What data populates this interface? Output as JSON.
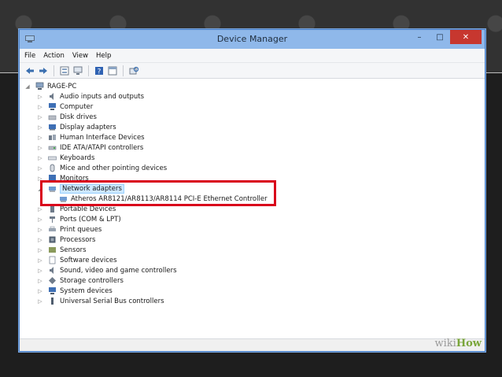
{
  "window": {
    "title": "Device Manager",
    "controls": {
      "minimize": "–",
      "maximize": "□",
      "close": "✕"
    }
  },
  "menu": [
    "File",
    "Action",
    "View",
    "Help"
  ],
  "toolbar": [
    "back-arrow-icon",
    "forward-arrow-icon",
    "properties-icon",
    "computer-icon",
    "help-icon",
    "console-icon",
    "scan-hardware-icon"
  ],
  "tree": {
    "root": "RAGE-PC",
    "items": [
      "Audio inputs and outputs",
      "Computer",
      "Disk drives",
      "Display adapters",
      "Human Interface Devices",
      "IDE ATA/ATAPI controllers",
      "Keyboards",
      "Mice and other pointing devices",
      "Monitors",
      "Network adapters",
      "Atheros AR8121/AR8113/AR8114 PCI-E Ethernet Controller",
      "Portable Devices",
      "Ports (COM & LPT)",
      "Print queues",
      "Processors",
      "Sensors",
      "Software devices",
      "Sound, video and game controllers",
      "Storage controllers",
      "System devices",
      "Universal Serial Bus controllers"
    ]
  },
  "watermark": {
    "wiki": "wiki",
    "how": "How"
  },
  "colors": {
    "highlight": "#d9001b",
    "titlebar": "#8fb8ea",
    "close": "#c7372f"
  }
}
